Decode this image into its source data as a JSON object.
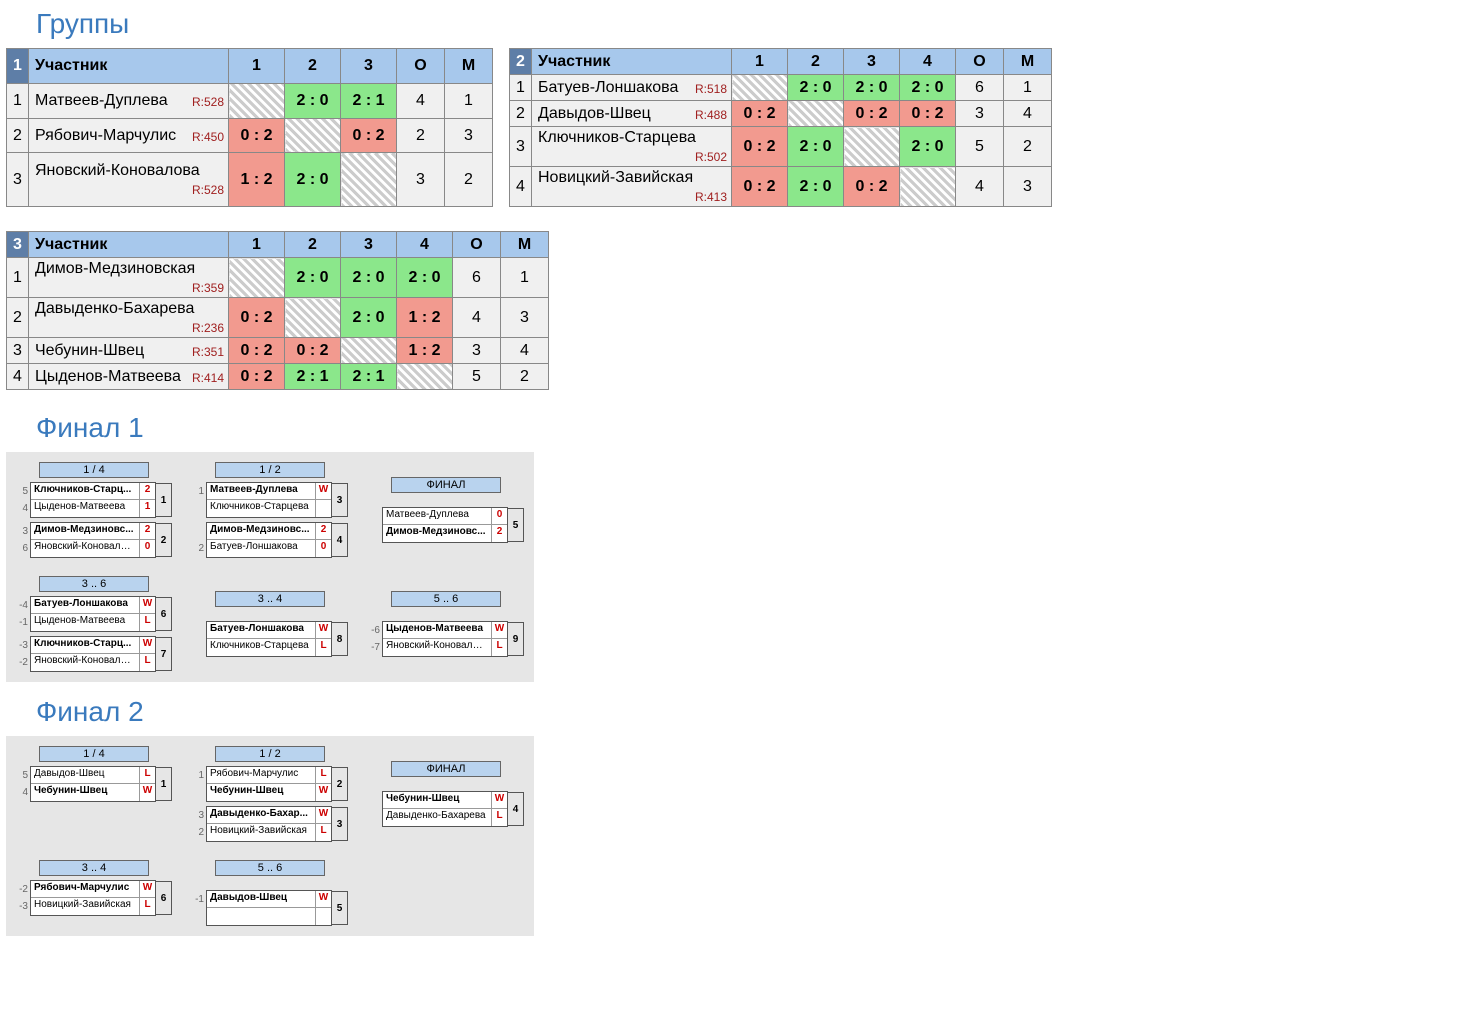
{
  "sections": {
    "groups_title": "Группы",
    "final1_title": "Финал 1",
    "final2_title": "Финал 2"
  },
  "headers": {
    "participant": "Участник",
    "points": "О",
    "place": "М"
  },
  "groups": [
    {
      "num": "1",
      "cols": [
        "1",
        "2",
        "3"
      ],
      "rows": [
        {
          "n": "1",
          "name": "Матвеев-Дуплева",
          "rating": "R:528",
          "cells": [
            {
              "t": "diag"
            },
            {
              "t": "win",
              "v": "2 : 0"
            },
            {
              "t": "win",
              "v": "2 : 1"
            }
          ],
          "o": "4",
          "m": "1"
        },
        {
          "n": "2",
          "name": "Рябович-Марчулис",
          "rating": "R:450",
          "cells": [
            {
              "t": "loss",
              "v": "0 : 2"
            },
            {
              "t": "diag"
            },
            {
              "t": "loss",
              "v": "0 : 2"
            }
          ],
          "o": "2",
          "m": "3"
        },
        {
          "n": "3",
          "name": "Яновский-Коновалова",
          "rating": "R:528",
          "cells": [
            {
              "t": "loss",
              "v": "1 : 2"
            },
            {
              "t": "win",
              "v": "2 : 0"
            },
            {
              "t": "diag"
            }
          ],
          "o": "3",
          "m": "2"
        }
      ]
    },
    {
      "num": "2",
      "cols": [
        "1",
        "2",
        "3",
        "4"
      ],
      "rows": [
        {
          "n": "1",
          "name": "Батуев-Лоншакова",
          "rating": "R:518",
          "cells": [
            {
              "t": "diag"
            },
            {
              "t": "win",
              "v": "2 : 0"
            },
            {
              "t": "win",
              "v": "2 : 0"
            },
            {
              "t": "win",
              "v": "2 : 0"
            }
          ],
          "o": "6",
          "m": "1"
        },
        {
          "n": "2",
          "name": "Давыдов-Швец",
          "rating": "R:488",
          "cells": [
            {
              "t": "loss",
              "v": "0 : 2"
            },
            {
              "t": "diag"
            },
            {
              "t": "loss",
              "v": "0 : 2"
            },
            {
              "t": "loss",
              "v": "0 : 2"
            }
          ],
          "o": "3",
          "m": "4"
        },
        {
          "n": "3",
          "name": "Ключников-Старцева",
          "rating": "R:502",
          "cells": [
            {
              "t": "loss",
              "v": "0 : 2"
            },
            {
              "t": "win",
              "v": "2 : 0"
            },
            {
              "t": "diag"
            },
            {
              "t": "win",
              "v": "2 : 0"
            }
          ],
          "o": "5",
          "m": "2"
        },
        {
          "n": "4",
          "name": "Новицкий-Завийская",
          "rating": "R:413",
          "cells": [
            {
              "t": "loss",
              "v": "0 : 2"
            },
            {
              "t": "win",
              "v": "2 : 0"
            },
            {
              "t": "loss",
              "v": "0 : 2"
            },
            {
              "t": "diag"
            }
          ],
          "o": "4",
          "m": "3"
        }
      ]
    },
    {
      "num": "3",
      "cols": [
        "1",
        "2",
        "3",
        "4"
      ],
      "rows": [
        {
          "n": "1",
          "name": "Димов-Медзиновская",
          "rating": "R:359",
          "cells": [
            {
              "t": "diag"
            },
            {
              "t": "win",
              "v": "2 : 0"
            },
            {
              "t": "win",
              "v": "2 : 0"
            },
            {
              "t": "win",
              "v": "2 : 0"
            }
          ],
          "o": "6",
          "m": "1"
        },
        {
          "n": "2",
          "name": "Давыденко-Бахарева",
          "rating": "R:236",
          "cells": [
            {
              "t": "loss",
              "v": "0 : 2"
            },
            {
              "t": "diag"
            },
            {
              "t": "win",
              "v": "2 : 0"
            },
            {
              "t": "loss",
              "v": "1 : 2"
            }
          ],
          "o": "4",
          "m": "3"
        },
        {
          "n": "3",
          "name": "Чебунин-Швец",
          "rating": "R:351",
          "cells": [
            {
              "t": "loss",
              "v": "0 : 2"
            },
            {
              "t": "loss",
              "v": "0 : 2"
            },
            {
              "t": "diag"
            },
            {
              "t": "loss",
              "v": "1 : 2"
            }
          ],
          "o": "3",
          "m": "4"
        },
        {
          "n": "4",
          "name": "Цыденов-Матвеева",
          "rating": "R:414",
          "cells": [
            {
              "t": "loss",
              "v": "0 : 2"
            },
            {
              "t": "win",
              "v": "2 : 1"
            },
            {
              "t": "win",
              "v": "2 : 1"
            },
            {
              "t": "diag"
            }
          ],
          "o": "5",
          "m": "2"
        }
      ]
    }
  ],
  "final1": {
    "top": [
      {
        "label": "1 / 4",
        "matches": [
          {
            "num": "1",
            "p": [
              {
                "seed": "5",
                "name": "Ключников-Старц...",
                "score": "2",
                "w": true
              },
              {
                "seed": "4",
                "name": "Цыденов-Матвеева",
                "score": "1"
              }
            ]
          },
          {
            "num": "2",
            "p": [
              {
                "seed": "3",
                "name": "Димов-Медзиновс...",
                "score": "2",
                "w": true
              },
              {
                "seed": "6",
                "name": "Яновский-Коновалова",
                "score": "0"
              }
            ]
          }
        ]
      },
      {
        "label": "1 / 2",
        "matches": [
          {
            "num": "3",
            "p": [
              {
                "seed": "1",
                "name": "Матвеев-Дуплева",
                "score": "W",
                "w": true
              },
              {
                "seed": "",
                "name": "Ключников-Старцева",
                "score": ""
              }
            ]
          },
          {
            "num": "4",
            "p": [
              {
                "seed": "",
                "name": "Димов-Медзиновс...",
                "score": "2",
                "w": true
              },
              {
                "seed": "2",
                "name": "Батуев-Лоншакова",
                "score": "0"
              }
            ]
          }
        ]
      },
      {
        "label": "ФИНАЛ",
        "matches": [
          {
            "num": "5",
            "p": [
              {
                "seed": "",
                "name": "Матвеев-Дуплева",
                "score": "0"
              },
              {
                "seed": "",
                "name": "Димов-Медзиновс...",
                "score": "2",
                "w": true
              }
            ]
          }
        ]
      }
    ],
    "bottom": [
      {
        "label": "3 .. 6",
        "matches": [
          {
            "num": "6",
            "p": [
              {
                "seed": "-4",
                "name": "Батуев-Лоншакова",
                "score": "W",
                "w": true
              },
              {
                "seed": "-1",
                "name": "Цыденов-Матвеева",
                "score": "L"
              }
            ]
          },
          {
            "num": "7",
            "p": [
              {
                "seed": "-3",
                "name": "Ключников-Старц...",
                "score": "W",
                "w": true
              },
              {
                "seed": "-2",
                "name": "Яновский-Коновалова",
                "score": "L"
              }
            ]
          }
        ]
      },
      {
        "label": "3 .. 4",
        "matches": [
          {
            "num": "8",
            "p": [
              {
                "seed": "",
                "name": "Батуев-Лоншакова",
                "score": "W",
                "w": true
              },
              {
                "seed": "",
                "name": "Ключников-Старцева",
                "score": "L"
              }
            ]
          }
        ]
      },
      {
        "label": "5 .. 6",
        "matches": [
          {
            "num": "9",
            "p": [
              {
                "seed": "-6",
                "name": "Цыденов-Матвеева",
                "score": "W",
                "w": true
              },
              {
                "seed": "-7",
                "name": "Яновский-Коновалова",
                "score": "L"
              }
            ]
          }
        ]
      }
    ]
  },
  "final2": {
    "top": [
      {
        "label": "1 / 4",
        "matches": [
          {
            "num": "1",
            "p": [
              {
                "seed": "5",
                "name": "Давыдов-Швец",
                "score": "L"
              },
              {
                "seed": "4",
                "name": "Чебунин-Швец",
                "score": "W",
                "w": true
              }
            ]
          }
        ]
      },
      {
        "label": "1 / 2",
        "matches": [
          {
            "num": "2",
            "p": [
              {
                "seed": "1",
                "name": "Рябович-Марчулис",
                "score": "L"
              },
              {
                "seed": "",
                "name": "Чебунин-Швец",
                "score": "W",
                "w": true
              }
            ]
          },
          {
            "num": "3",
            "p": [
              {
                "seed": "3",
                "name": "Давыденко-Бахар...",
                "score": "W",
                "w": true
              },
              {
                "seed": "2",
                "name": "Новицкий-Завийская",
                "score": "L"
              }
            ]
          }
        ]
      },
      {
        "label": "ФИНАЛ",
        "matches": [
          {
            "num": "4",
            "p": [
              {
                "seed": "",
                "name": "Чебунин-Швец",
                "score": "W",
                "w": true
              },
              {
                "seed": "",
                "name": "Давыденко-Бахарева",
                "score": "L"
              }
            ]
          }
        ]
      }
    ],
    "bottom": [
      {
        "label": "3 .. 4",
        "matches": [
          {
            "num": "6",
            "p": [
              {
                "seed": "-2",
                "name": "Рябович-Марчулис",
                "score": "W",
                "w": true
              },
              {
                "seed": "-3",
                "name": "Новицкий-Завийская",
                "score": "L"
              }
            ]
          }
        ]
      },
      {
        "label": "5 .. 6",
        "matches": [
          {
            "num": "5",
            "p": [
              {
                "seed": "-1",
                "name": "Давыдов-Швец",
                "score": "W",
                "w": true
              },
              {
                "seed": "",
                "name": "",
                "score": ""
              }
            ]
          }
        ]
      }
    ]
  }
}
